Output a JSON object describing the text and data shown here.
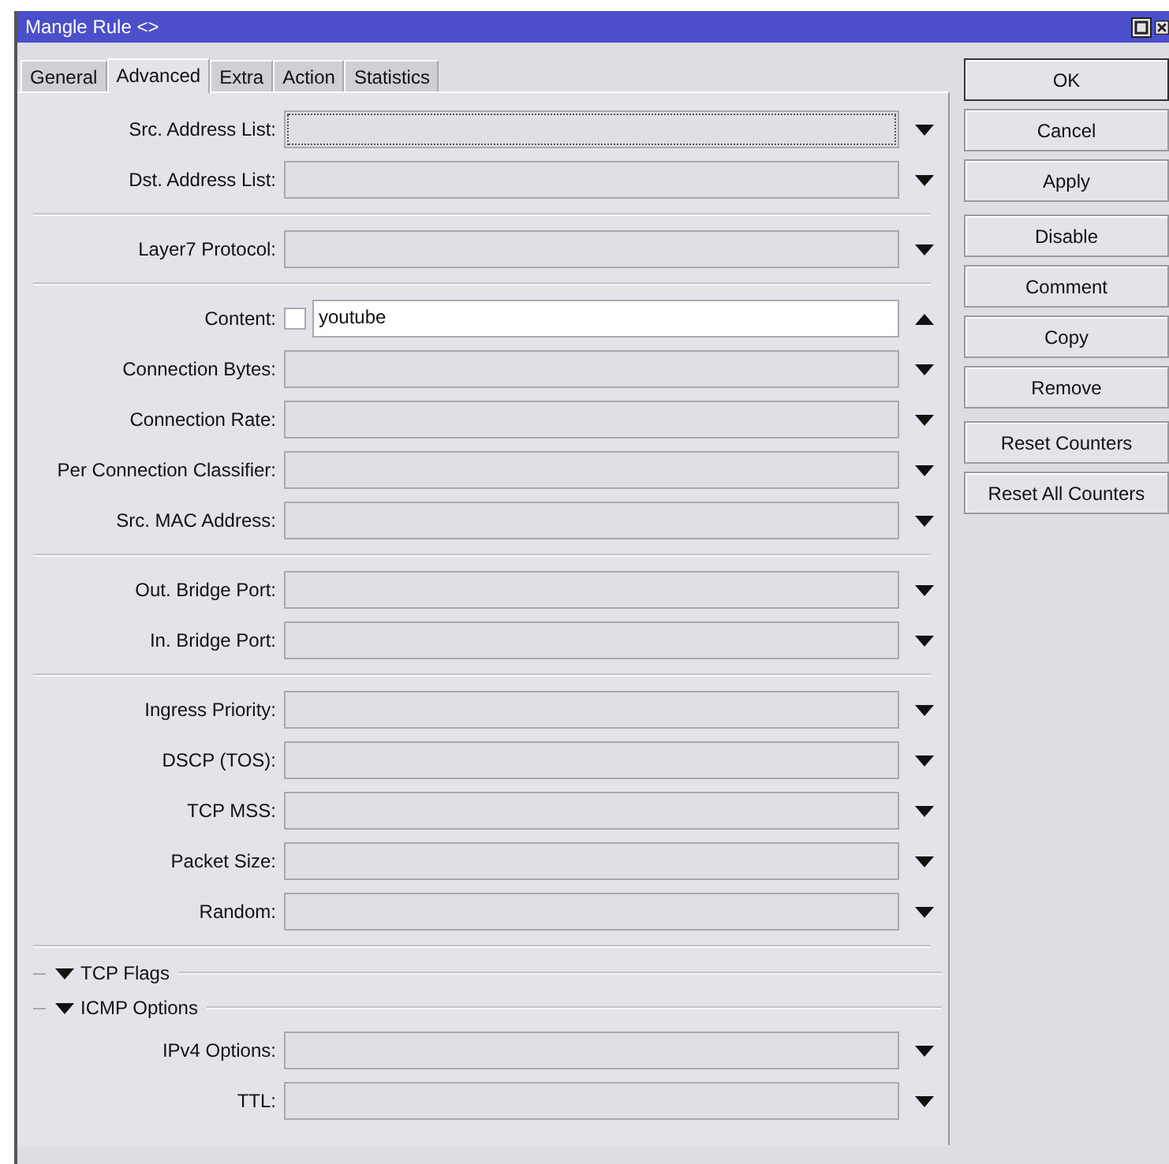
{
  "window": {
    "title": "Mangle Rule <>"
  },
  "tabs": [
    {
      "label": "General",
      "selected": false
    },
    {
      "label": "Advanced",
      "selected": true
    },
    {
      "label": "Extra",
      "selected": false
    },
    {
      "label": "Action",
      "selected": false
    },
    {
      "label": "Statistics",
      "selected": false
    }
  ],
  "form": [
    {
      "kind": "group",
      "fields": [
        {
          "label": "Src. Address List:",
          "focused": true,
          "expanded": false
        },
        {
          "label": "Dst. Address List:",
          "focused": false,
          "expanded": false
        }
      ]
    },
    {
      "kind": "group",
      "fields": [
        {
          "label": "Layer7 Protocol:",
          "focused": false,
          "expanded": false
        }
      ]
    },
    {
      "kind": "group",
      "fields": [
        {
          "label": "Content:",
          "negate": {
            "checked": false
          },
          "value": "youtube",
          "focused": false,
          "expanded": true
        },
        {
          "label": "Connection Bytes:",
          "focused": false,
          "expanded": false
        },
        {
          "label": "Connection Rate:",
          "focused": false,
          "expanded": false
        },
        {
          "label": "Per Connection Classifier:",
          "focused": false,
          "expanded": false
        },
        {
          "label": "Src. MAC Address:",
          "focused": false,
          "expanded": false
        }
      ]
    },
    {
      "kind": "group",
      "fields": [
        {
          "label": "Out. Bridge Port:",
          "focused": false,
          "expanded": false
        },
        {
          "label": "In. Bridge Port:",
          "focused": false,
          "expanded": false
        }
      ]
    },
    {
      "kind": "group",
      "fields": [
        {
          "label": "Ingress Priority:",
          "focused": false,
          "expanded": false
        },
        {
          "label": "DSCP (TOS):",
          "focused": false,
          "expanded": false
        },
        {
          "label": "TCP MSS:",
          "focused": false,
          "expanded": false
        },
        {
          "label": "Packet Size:",
          "focused": false,
          "expanded": false
        },
        {
          "label": "Random:",
          "focused": false,
          "expanded": false
        }
      ]
    },
    {
      "kind": "section",
      "title": "TCP Flags",
      "expanded": false
    },
    {
      "kind": "section",
      "title": "ICMP Options",
      "expanded": false,
      "fields": [
        {
          "label": "IPv4 Options:",
          "focused": false,
          "expanded": false
        },
        {
          "label": "TTL:",
          "focused": false,
          "expanded": false
        }
      ]
    }
  ],
  "buttons": [
    [
      {
        "label": "OK",
        "default": true
      },
      {
        "label": "Cancel",
        "default": false
      },
      {
        "label": "Apply",
        "default": false
      }
    ],
    [
      {
        "label": "Disable",
        "default": false
      },
      {
        "label": "Comment",
        "default": false
      },
      {
        "label": "Copy",
        "default": false
      },
      {
        "label": "Remove",
        "default": false
      }
    ],
    [
      {
        "label": "Reset Counters",
        "default": false
      },
      {
        "label": "Reset All Counters",
        "default": false
      }
    ]
  ]
}
